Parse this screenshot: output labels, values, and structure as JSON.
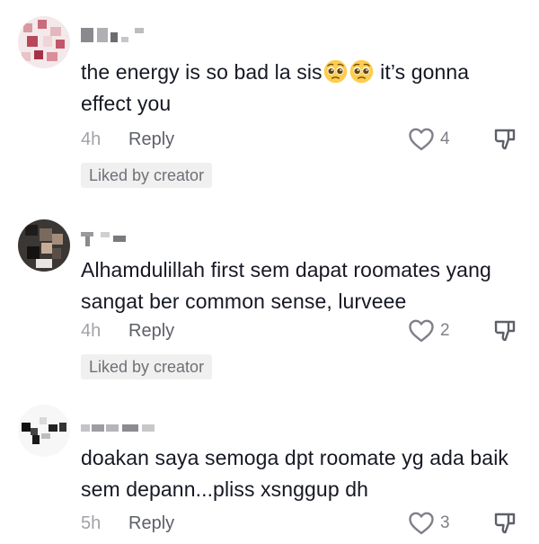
{
  "comments": [
    {
      "text_before_emoji": "the energy is so bad la sis",
      "emojis": [
        "pleading-face",
        "pleading-face"
      ],
      "text_after_emoji": " it’s gonna effect you",
      "time": "4h",
      "reply_label": "Reply",
      "like_count": "4",
      "liked_by_creator": "Liked by creator"
    },
    {
      "text": "Alhamdulillah first sem dapat roomates yang sangat ber common sense, lurveee",
      "time": "4h",
      "reply_label": "Reply",
      "like_count": "2",
      "liked_by_creator": "Liked by creator"
    },
    {
      "text": "doakan saya semoga dpt roomate yg ada baik sem depann...pliss xsnggup dh",
      "time": "5h",
      "reply_label": "Reply",
      "like_count": "3"
    }
  ],
  "icons": {
    "like": "heart-outline-icon",
    "dislike": "thumbs-down-icon",
    "emoji": "pleading-face-emoji"
  },
  "colors": {
    "text": "#161823",
    "muted": "#a1a2a7",
    "reply": "#5e6068",
    "badge_bg": "#f0f0f1"
  }
}
